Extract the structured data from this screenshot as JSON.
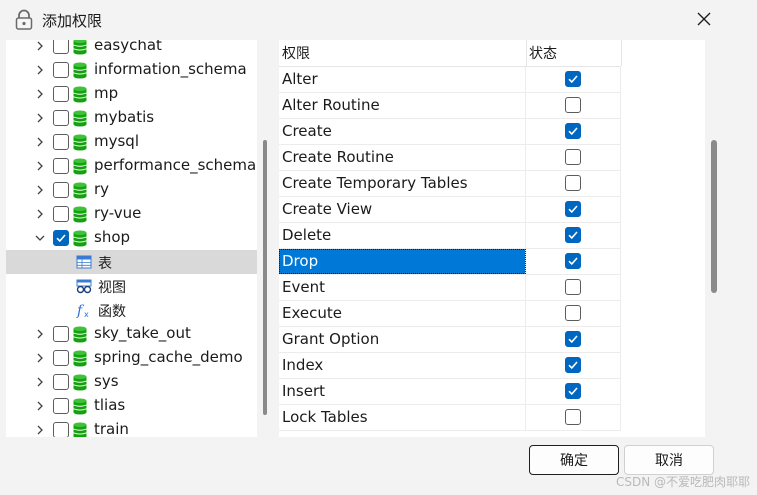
{
  "window": {
    "title": "添加权限",
    "icon": "lock-icon",
    "close_icon": "close-icon"
  },
  "tree": {
    "items": [
      {
        "label": "easychat",
        "checked": false,
        "expanded": false
      },
      {
        "label": "information_schema",
        "checked": false,
        "expanded": false
      },
      {
        "label": "mp",
        "checked": false,
        "expanded": false
      },
      {
        "label": "mybatis",
        "checked": false,
        "expanded": false
      },
      {
        "label": "mysql",
        "checked": false,
        "expanded": false
      },
      {
        "label": "performance_schema",
        "checked": false,
        "expanded": false
      },
      {
        "label": "ry",
        "checked": false,
        "expanded": false
      },
      {
        "label": "ry-vue",
        "checked": false,
        "expanded": false
      },
      {
        "label": "shop",
        "checked": true,
        "expanded": true,
        "children": [
          {
            "label": "表",
            "icon": "table-icon",
            "selected": true
          },
          {
            "label": "视图",
            "icon": "view-icon",
            "selected": false
          },
          {
            "label": "函数",
            "icon": "function-icon",
            "selected": false
          }
        ]
      },
      {
        "label": "sky_take_out",
        "checked": false,
        "expanded": false
      },
      {
        "label": "spring_cache_demo",
        "checked": false,
        "expanded": false
      },
      {
        "label": "sys",
        "checked": false,
        "expanded": false
      },
      {
        "label": "tlias",
        "checked": false,
        "expanded": false
      },
      {
        "label": "train",
        "checked": false,
        "expanded": false
      }
    ]
  },
  "permissions": {
    "headers": {
      "name": "权限",
      "status": "状态"
    },
    "rows": [
      {
        "name": "Alter",
        "checked": true,
        "selected": false
      },
      {
        "name": "Alter Routine",
        "checked": false,
        "selected": false
      },
      {
        "name": "Create",
        "checked": true,
        "selected": false
      },
      {
        "name": "Create Routine",
        "checked": false,
        "selected": false
      },
      {
        "name": "Create Temporary Tables",
        "checked": false,
        "selected": false
      },
      {
        "name": "Create View",
        "checked": true,
        "selected": false
      },
      {
        "name": "Delete",
        "checked": true,
        "selected": false
      },
      {
        "name": "Drop",
        "checked": true,
        "selected": true
      },
      {
        "name": "Event",
        "checked": false,
        "selected": false
      },
      {
        "name": "Execute",
        "checked": false,
        "selected": false
      },
      {
        "name": "Grant Option",
        "checked": true,
        "selected": false
      },
      {
        "name": "Index",
        "checked": true,
        "selected": false
      },
      {
        "name": "Insert",
        "checked": true,
        "selected": false
      },
      {
        "name": "Lock Tables",
        "checked": false,
        "selected": false
      }
    ]
  },
  "footer": {
    "ok_label": "确定",
    "cancel_label": "取消",
    "watermark": "CSDN @不爱吃肥肉耶耶"
  },
  "colors": {
    "accent": "#0067c0",
    "selection": "#0078d7",
    "tree_selection": "#d9d9d9",
    "db_icon": "#13a10e"
  }
}
